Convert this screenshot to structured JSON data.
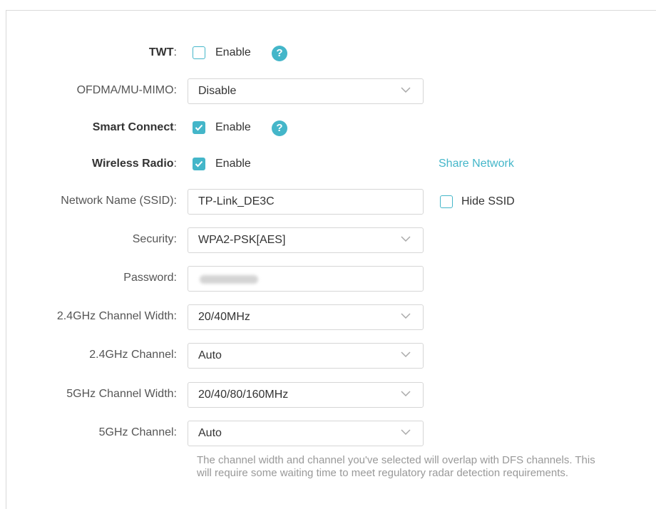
{
  "twt": {
    "label": "TWT",
    "checkbox_label": "Enable",
    "checked": false
  },
  "ofdma": {
    "label": "OFDMA/MU-MIMO",
    "value": "Disable"
  },
  "smart_connect": {
    "label": "Smart Connect",
    "checkbox_label": "Enable",
    "checked": true
  },
  "wireless_radio": {
    "label": "Wireless Radio",
    "checkbox_label": "Enable",
    "checked": true,
    "share_link": "Share Network"
  },
  "ssid": {
    "label": "Network Name (SSID)",
    "value": "TP-Link_DE3C",
    "hide_label": "Hide SSID",
    "hide_checked": false
  },
  "security": {
    "label": "Security",
    "value": "WPA2-PSK[AES]"
  },
  "password": {
    "label": "Password"
  },
  "ch_width_24": {
    "label": "2.4GHz Channel Width",
    "value": "20/40MHz"
  },
  "channel_24": {
    "label": "2.4GHz Channel",
    "value": "Auto"
  },
  "ch_width_5": {
    "label": "5GHz Channel Width",
    "value": "20/40/80/160MHz"
  },
  "channel_5": {
    "label": "5GHz Channel",
    "value": "Auto"
  },
  "note": "The channel width and channel you've selected will overlap with DFS channels. This will require some waiting time to meet regulatory radar detection requirements.",
  "colors": {
    "accent": "#44b6c9",
    "border": "#d6d6d6",
    "note": "#999999"
  }
}
